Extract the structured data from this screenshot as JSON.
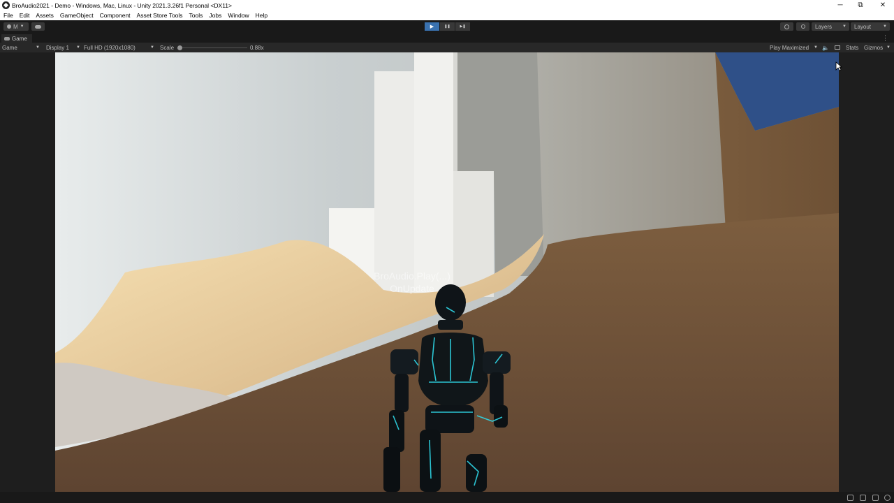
{
  "window": {
    "title": "BroAudio2021 - Demo - Windows, Mac, Linux - Unity 2021.3.26f1 Personal <DX11>",
    "controls": [
      "─",
      "⧉",
      "✕"
    ]
  },
  "menu": [
    "File",
    "Edit",
    "Assets",
    "GameObject",
    "Component",
    "Asset Store Tools",
    "Tools",
    "Jobs",
    "Window",
    "Help"
  ],
  "toolbar": {
    "account_label": "M",
    "play_icon": "▶",
    "pause_icon": "❚❚",
    "step_icon": "▶❚",
    "layers_label": "Layers",
    "layout_label": "Layout"
  },
  "game_view": {
    "tab_label": "Game",
    "mode": "Game",
    "display": "Display 1",
    "resolution": "Full HD (1920x1080)",
    "scale_label": "Scale",
    "scale_value": "0.88x",
    "play_mode": "Play Maximized",
    "stats_label": "Stats",
    "gizmos_label": "Gizmos"
  },
  "scene": {
    "sign_line1": "BroAudio.Play(...)",
    "sign_line2": "OnUpdate"
  },
  "colors": {
    "accent": "#3a72b0",
    "editor_bg": "#191919",
    "panel_bg": "#282828",
    "sand_light": "#e9cf9a",
    "sand_dark": "#6b4d30",
    "sky": "#2e4d82",
    "robot_glow": "#2fd8e8"
  }
}
